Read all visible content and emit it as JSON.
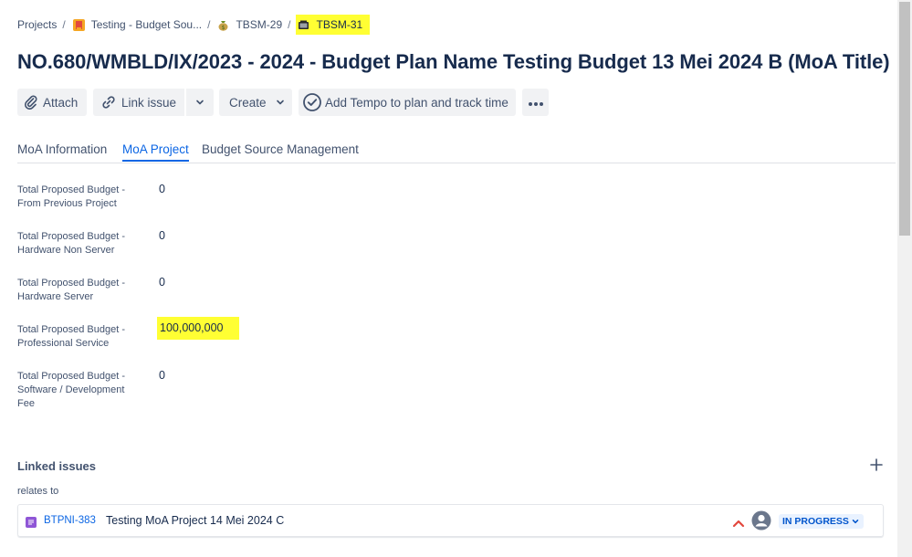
{
  "breadcrumb": {
    "items": [
      {
        "label": "Projects",
        "icon": ""
      },
      {
        "label": "Testing - Budget Sou...",
        "icon": "project-icon"
      },
      {
        "label": "TBSM-29",
        "icon": "money-bag-icon"
      },
      {
        "label": "TBSM-31",
        "icon": "issue-type-icon"
      }
    ],
    "separator": "/"
  },
  "issue_title": "NO.680/WMBLD/IX/2023 - 2024 - Budget Plan Name Testing Budget 13 Mei 2024 B (MoA Title)",
  "toolbar": {
    "attach_label": "Attach",
    "link_issue_label": "Link issue",
    "create_label": "Create",
    "tempo_label": "Add Tempo to plan and track time",
    "more_icon": "more-icon"
  },
  "tabs": [
    {
      "label": "MoA Information",
      "active": false
    },
    {
      "label": "MoA Project",
      "active": true
    },
    {
      "label": "Budget Source Management",
      "active": false
    }
  ],
  "fields": [
    {
      "label": "Total Proposed Budget - From Previous Project",
      "value": "0",
      "highlighted": false
    },
    {
      "label": "Total Proposed Budget - Hardware Non Server",
      "value": "0",
      "highlighted": false
    },
    {
      "label": "Total Proposed Budget - Hardware Server",
      "value": "0",
      "highlighted": false
    },
    {
      "label": "Total Proposed Budget - Professional Service",
      "value": "100,000,000",
      "highlighted": true
    },
    {
      "label": "Total Proposed Budget - Software / Development Fee",
      "value": "0",
      "highlighted": false
    }
  ],
  "linked_issues": {
    "header": "Linked issues",
    "relation": "relates to",
    "items": [
      {
        "key": "BTPNI-383",
        "summary": "Testing MoA Project 14 Mei 2024 C",
        "priority": "high",
        "status": "IN PROGRESS"
      }
    ]
  },
  "colors": {
    "highlight": "#ffff33",
    "accent": "#0c66e4",
    "priority_high": "#e2483d",
    "issue_icon": "#8f56d6"
  }
}
